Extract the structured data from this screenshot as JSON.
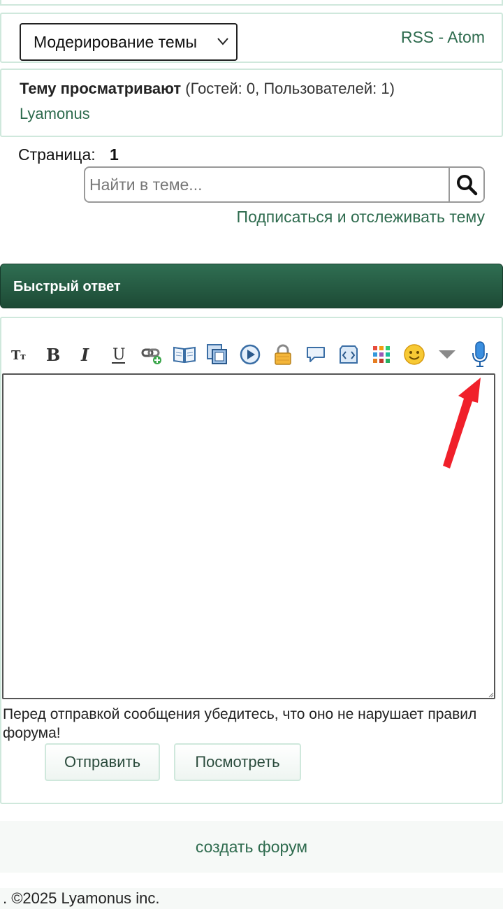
{
  "moderation": {
    "select_label": "Модерирование темы",
    "rss_label": "RSS - Atom"
  },
  "viewers": {
    "title": "Тему просматривают",
    "counts": "(Гостей: 0, Пользователей: 1)",
    "users": [
      "Lyamonus"
    ]
  },
  "pagination": {
    "label": "Страница:",
    "current": "1"
  },
  "search": {
    "placeholder": "Найти в теме..."
  },
  "subscribe_label": "Подписаться и отслеживать тему",
  "quick_reply": {
    "header": "Быстрый ответ",
    "toolbar": [
      "font-size-icon",
      "bold-icon",
      "italic-icon",
      "underline-icon",
      "insert-link-icon",
      "book-icon",
      "insert-image-icon",
      "insert-video-icon",
      "lock-hide-icon",
      "quote-icon",
      "code-icon",
      "color-palette-icon",
      "smiley-icon",
      "more-dropdown-icon",
      "microphone-icon"
    ],
    "textarea_value": "",
    "note": "Перед отправкой сообщения убедитесь, что оно не нарушает правил форума!",
    "send_label": "Отправить",
    "preview_label": "Посмотреть"
  },
  "create_forum_label": "создать форум",
  "footer": ". ©2025 Lyamonus inc.",
  "colors": {
    "accent": "#2e6b4e",
    "header_dark": "#1d4a35",
    "panel_border": "#cfe8dc",
    "annotation_arrow": "#f0202a"
  }
}
